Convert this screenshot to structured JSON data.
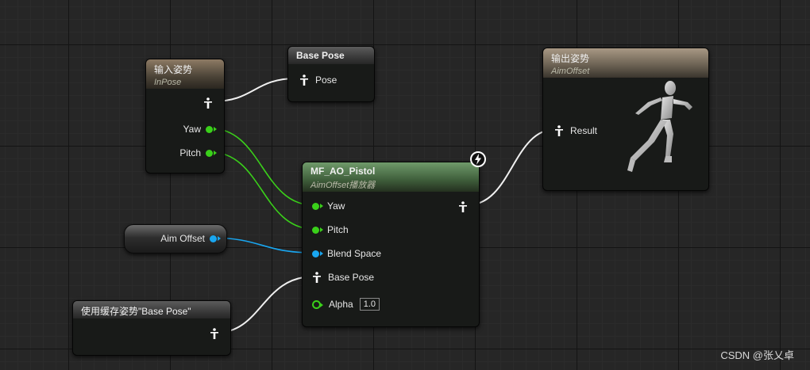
{
  "input_pose_node": {
    "title": "输入姿势",
    "subtitle": "InPose",
    "pins": {
      "yaw": "Yaw",
      "pitch": "Pitch"
    }
  },
  "base_pose_node": {
    "title": "Base Pose",
    "pin": "Pose"
  },
  "output_pose_node": {
    "title": "输出姿势",
    "subtitle": "AimOffset",
    "pin": "Result"
  },
  "aim_offset_player": {
    "title": "MF_AO_Pistol",
    "subtitle": "AimOffset播放器",
    "pins": {
      "yaw": "Yaw",
      "pitch": "Pitch",
      "blend_space": "Blend Space",
      "base_pose": "Base Pose",
      "alpha": "Alpha"
    },
    "alpha_value": "1.0"
  },
  "aim_offset_variable": {
    "label": "Aim Offset"
  },
  "cached_pose_node": {
    "title": "使用缓存姿势\"Base Pose\""
  },
  "watermark": "CSDN @张乂卓",
  "colors": {
    "float_pin": "#3ad01a",
    "object_pin": "#19a6f0",
    "pose_wire": "#f0f0f0"
  }
}
